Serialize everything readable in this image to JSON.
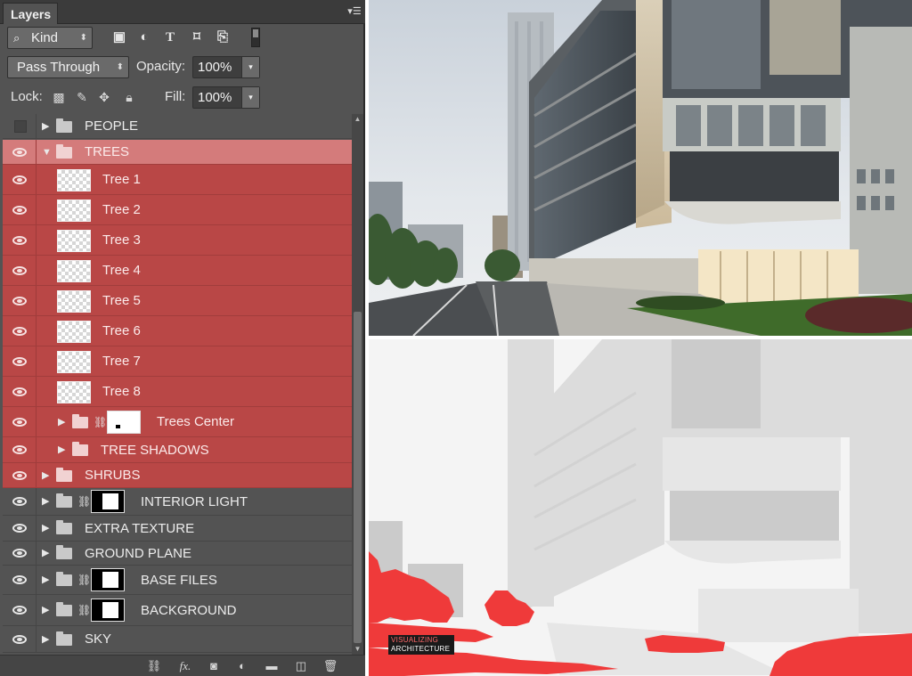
{
  "panel": {
    "tab_title": "Layers",
    "menu_icon": "panel-menu-icon",
    "filter": {
      "label": "Kind",
      "icon": "search-icon",
      "type_icons": [
        "image-filter-icon",
        "adjustment-filter-icon",
        "type-filter-icon",
        "shape-filter-icon",
        "smart-object-filter-icon"
      ]
    },
    "blend_mode": "Pass Through",
    "opacity": {
      "label": "Opacity:",
      "value": "100%"
    },
    "lock": {
      "label": "Lock:",
      "icons": [
        "lock-transparent-icon",
        "lock-paint-icon",
        "lock-move-icon",
        "lock-all-icon"
      ]
    },
    "fill": {
      "label": "Fill:",
      "value": "100%"
    }
  },
  "layers": [
    {
      "name": "PEOPLE",
      "kind": "group",
      "visible": false,
      "expanded": false,
      "selected": false,
      "indent": 0
    },
    {
      "name": "TREES",
      "kind": "group",
      "visible": true,
      "expanded": true,
      "selected": true,
      "header": true,
      "indent": 0
    },
    {
      "name": "Tree 1",
      "kind": "layer",
      "visible": true,
      "selected": true,
      "indent": 1
    },
    {
      "name": "Tree 2",
      "kind": "layer",
      "visible": true,
      "selected": true,
      "indent": 1
    },
    {
      "name": "Tree 3",
      "kind": "layer",
      "visible": true,
      "selected": true,
      "indent": 1
    },
    {
      "name": "Tree 4",
      "kind": "layer",
      "visible": true,
      "selected": true,
      "indent": 1
    },
    {
      "name": "Tree 5",
      "kind": "layer",
      "visible": true,
      "selected": true,
      "indent": 1
    },
    {
      "name": "Tree 6",
      "kind": "layer",
      "visible": true,
      "selected": true,
      "indent": 1
    },
    {
      "name": "Tree 7",
      "kind": "layer",
      "visible": true,
      "selected": true,
      "indent": 1
    },
    {
      "name": "Tree 8",
      "kind": "layer",
      "visible": true,
      "selected": true,
      "indent": 1
    },
    {
      "name": "Trees Center",
      "kind": "group-mask",
      "mask": "white",
      "visible": true,
      "expanded": false,
      "selected": true,
      "indent": 1
    },
    {
      "name": "TREE SHADOWS",
      "kind": "group",
      "visible": true,
      "expanded": false,
      "selected": true,
      "indent": 1
    },
    {
      "name": "SHRUBS",
      "kind": "group",
      "visible": true,
      "expanded": false,
      "selected": true,
      "indent": 0
    },
    {
      "name": "INTERIOR LIGHT",
      "kind": "group-mask",
      "mask": "black",
      "visible": true,
      "expanded": false,
      "selected": false,
      "indent": 0
    },
    {
      "name": "EXTRA TEXTURE",
      "kind": "group",
      "visible": true,
      "expanded": false,
      "selected": false,
      "indent": 0
    },
    {
      "name": "GROUND PLANE",
      "kind": "group",
      "visible": true,
      "expanded": false,
      "selected": false,
      "indent": 0
    },
    {
      "name": "BASE FILES",
      "kind": "group-mask",
      "mask": "black",
      "visible": true,
      "expanded": false,
      "selected": false,
      "indent": 0
    },
    {
      "name": "BACKGROUND",
      "kind": "group-mask",
      "mask": "black",
      "visible": true,
      "expanded": false,
      "selected": false,
      "indent": 0
    },
    {
      "name": "SKY",
      "kind": "group",
      "visible": true,
      "expanded": false,
      "selected": false,
      "indent": 0
    }
  ],
  "footer_icons": [
    "link-layers-icon",
    "layer-style-fx-icon",
    "add-mask-icon",
    "adjustment-layer-icon",
    "new-group-icon",
    "new-layer-icon",
    "delete-layer-icon"
  ],
  "images": {
    "top": "architectural-render",
    "bottom": "tree-mask-overlay"
  },
  "watermark": {
    "line1": "VISUALIZING",
    "line2": "ARCHITECTURE"
  },
  "colors": {
    "selection": "#b94746",
    "selection_header": "#d47b7b",
    "panel_bg": "#535353",
    "mask_red": "#ef3a3a"
  }
}
